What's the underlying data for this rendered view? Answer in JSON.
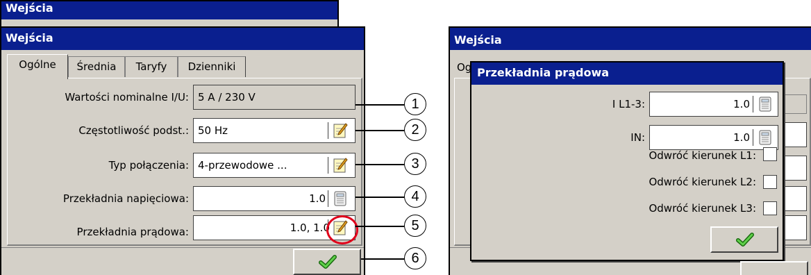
{
  "left_window": {
    "back_title": "Wejścia",
    "title": "Wejścia",
    "tabs": [
      {
        "label": "Ogólne",
        "active": true
      },
      {
        "label": "Średnia",
        "active": false
      },
      {
        "label": "Taryfy",
        "active": false
      },
      {
        "label": "Dzienniki",
        "active": false
      }
    ],
    "rows": [
      {
        "label": "Wartości nominalne I/U:",
        "value": "5 A / 230 V",
        "icon": "none"
      },
      {
        "label": "Częstotliwość podst.:",
        "value": "50 Hz",
        "icon": "edit-icon"
      },
      {
        "label": "Typ połączenia:",
        "value": "4-przewodowe ...",
        "icon": "edit-icon"
      },
      {
        "label": "Przekładnia napięciowa:",
        "value": "1.0",
        "icon": "keypad-icon"
      },
      {
        "label": "Przekładnia prądowa:",
        "value": "1.0, 1.0",
        "icon": "edit-icon"
      }
    ],
    "highlight_color": "#e0001a"
  },
  "callouts": [
    "1",
    "2",
    "3",
    "4",
    "5",
    "6"
  ],
  "right_window": {
    "back_title": "Wejścia",
    "back_tab_fragment": "Ogó",
    "dialog_title": "Przekładnia prądowa",
    "fields": [
      {
        "label": "I L1-3:",
        "value": "1.0"
      },
      {
        "label": "IN:",
        "value": "1.0"
      }
    ],
    "checks": [
      {
        "label": "Odwróć kierunek L1:",
        "checked": false
      },
      {
        "label": "Odwróć kierunek L2:",
        "checked": false
      },
      {
        "label": "Odwróć kierunek L3:",
        "checked": false
      }
    ]
  },
  "colors": {
    "titlebar": "#0a1f8f",
    "face": "#d4d0c8",
    "ok_check": "#3aa82a"
  }
}
